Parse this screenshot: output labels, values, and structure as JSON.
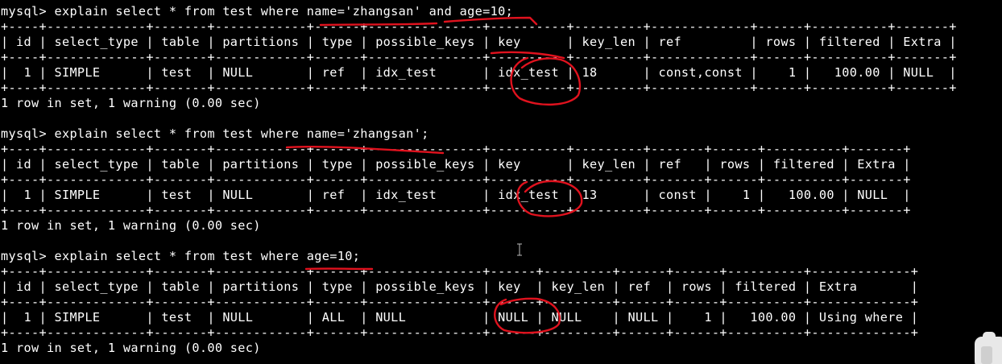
{
  "terminal": {
    "colors": {
      "background": "#000000",
      "text": "#ffffff",
      "annotation_ink": "#e0121e"
    },
    "blocks": [
      {
        "command": "mysql> explain select * from test where name='zhangsan' and age=10;",
        "border": "+----+-------------+-------+------------+------+---------------+----------+---------+-------------+------+----------+-------+",
        "header": "| id | select_type | table | partitions | type | possible_keys | key      | key_len | ref         | rows | filtered | Extra |",
        "row": "|  1 | SIMPLE      | test  | NULL       | ref  | idx_test      | idx_test | 18      | const,const |    1 |   100.00 | NULL  |",
        "result": "1 row in set, 1 warning (0.00 sec)"
      },
      {
        "command": "mysql> explain select * from test where name='zhangsan';",
        "border": "+----+-------------+-------+------------+------+---------------+----------+---------+-------+------+----------+-------+",
        "header": "| id | select_type | table | partitions | type | possible_keys | key      | key_len | ref   | rows | filtered | Extra |",
        "row": "|  1 | SIMPLE      | test  | NULL       | ref  | idx_test      | idx_test | 13      | const |    1 |   100.00 | NULL  |",
        "result": "1 row in set, 1 warning (0.00 sec)"
      },
      {
        "command": "mysql> explain select * from test where age=10;",
        "border": "+----+-------------+-------+------------+------+---------------+------+---------+------+------+----------+-------------+",
        "header": "| id | select_type | table | partitions | type | possible_keys | key  | key_len | ref  | rows | filtered | Extra       |",
        "row": "|  1 | SIMPLE      | test  | NULL       | ALL  | NULL          | NULL | NULL    | NULL |    1 |   100.00 | Using where |",
        "result": "1 row in set, 1 warning (0.00 sec)"
      }
    ]
  },
  "overlays": {
    "cursor_icon": "text-cursor-ibeam-icon",
    "corner_icon": "window-corner-widget-icon"
  }
}
